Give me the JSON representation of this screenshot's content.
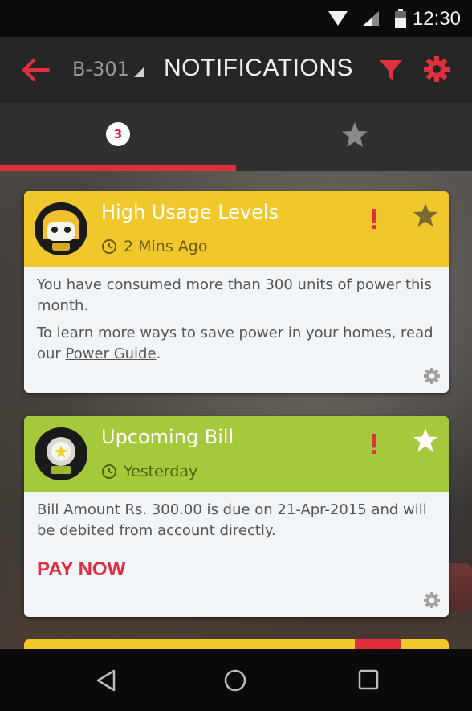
{
  "status_bar": {
    "time": "12:30"
  },
  "app_bar": {
    "unit": "B-301",
    "title": "NOTIFICATIONS"
  },
  "tabs": {
    "unread_count": "3"
  },
  "colors": {
    "accent": "#e0303e",
    "warning_card": "#f1c82c",
    "info_card": "#a6c93c"
  },
  "notifications": [
    {
      "title": "High Usage Levels",
      "time": "2 Mins Ago",
      "text1": "You have consumed more than 300 units of power this month.",
      "text2_prefix": "To learn more ways to save power in your homes, read our ",
      "link": "Power Guide",
      "text2_suffix": ".",
      "alert": "!"
    },
    {
      "title": "Upcoming Bill",
      "time": "Yesterday",
      "text1": "Bill Amount Rs. 300.00 is due on 21-Apr-2015 and will be debited from account directly.",
      "action": "PAY NOW",
      "alert": "!"
    }
  ]
}
